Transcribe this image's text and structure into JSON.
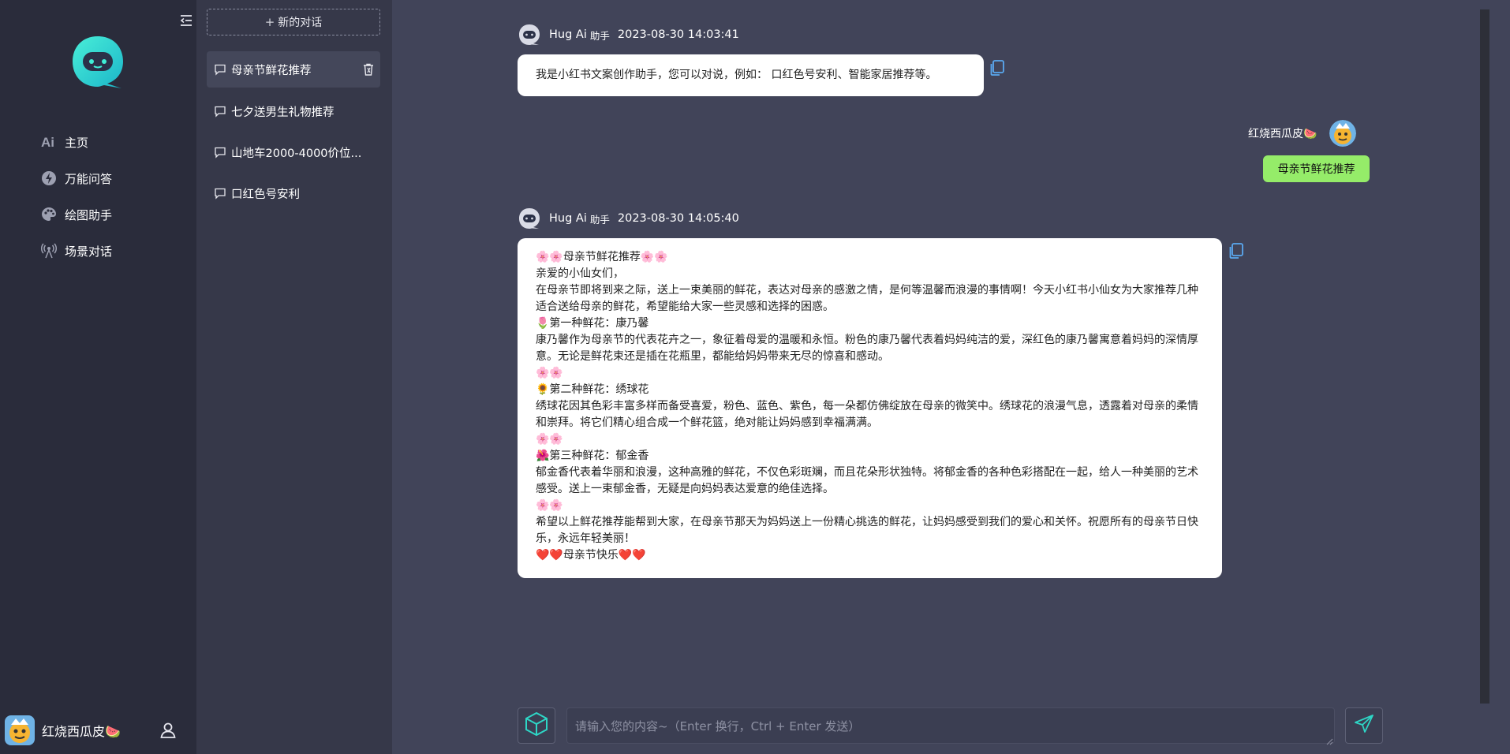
{
  "nav": {
    "items": [
      {
        "label": "主页",
        "icon": "ai-icon"
      },
      {
        "label": "万能问答",
        "icon": "lightning-icon"
      },
      {
        "label": "绘图助手",
        "icon": "palette-icon"
      },
      {
        "label": "场景对话",
        "icon": "broadcast-icon"
      }
    ],
    "user_name": "红烧西瓜皮🍉"
  },
  "conversations": {
    "new_label": "新的对话",
    "items": [
      {
        "title": "母亲节鲜花推荐",
        "active": true
      },
      {
        "title": "七夕送男生礼物推荐",
        "active": false
      },
      {
        "title": "山地车2000-4000价位...",
        "active": false
      },
      {
        "title": "口红色号安利",
        "active": false
      }
    ]
  },
  "messages": [
    {
      "role": "bot",
      "name": "Hug Ai",
      "subtitle": "助手",
      "time": "2023-08-30 14:03:41",
      "text": "我是小红书文案创作助手，您可以对说，例如： 口红色号安利、智能家居推荐等。"
    },
    {
      "role": "user",
      "name": "红烧西瓜皮🍉",
      "text": "母亲节鲜花推荐"
    },
    {
      "role": "bot",
      "name": "Hug Ai",
      "subtitle": "助手",
      "time": "2023-08-30 14:05:40",
      "lines": [
        "🌸🌸母亲节鲜花推荐🌸🌸",
        "亲爱的小仙女们，",
        "在母亲节即将到来之际，送上一束美丽的鲜花，表达对母亲的感激之情，是何等温馨而浪漫的事情啊！今天小红书小仙女为大家推荐几种适合送给母亲的鲜花，希望能给大家一些灵感和选择的困惑。",
        "🌷第一种鲜花：康乃馨",
        "康乃馨作为母亲节的代表花卉之一，象征着母爱的温暖和永恒。粉色的康乃馨代表着妈妈纯洁的爱，深红色的康乃馨寓意着妈妈的深情厚意。无论是鲜花束还是插在花瓶里，都能给妈妈带来无尽的惊喜和感动。",
        "🌸🌸",
        "🌻第二种鲜花：绣球花",
        "绣球花因其色彩丰富多样而备受喜爱，粉色、蓝色、紫色，每一朵都仿佛绽放在母亲的微笑中。绣球花的浪漫气息，透露着对母亲的柔情和崇拜。将它们精心组合成一个鲜花篮，绝对能让妈妈感到幸福满满。",
        "🌸🌸",
        "🌺第三种鲜花：郁金香",
        "郁金香代表着华丽和浪漫，这种高雅的鲜花，不仅色彩斑斓，而且花朵形状独特。将郁金香的各种色彩搭配在一起，给人一种美丽的艺术感受。送上一束郁金香，无疑是向妈妈表达爱意的绝佳选择。",
        "🌸🌸",
        "希望以上鲜花推荐能帮到大家，在母亲节那天为妈妈送上一份精心挑选的鲜花，让妈妈感受到我们的爱心和关怀。祝愿所有的母亲节日快乐，永远年轻美丽！",
        "❤️❤️母亲节快乐❤️❤️"
      ]
    }
  ],
  "input": {
    "placeholder": "请输入您的内容~（Enter 换行，Ctrl + Enter 发送）"
  },
  "colors": {
    "accent": "#2ed6c6",
    "user_bubble": "#95ec69",
    "nav_bg": "#2a2c3b",
    "list_bg": "#363849",
    "main_bg": "#414459"
  }
}
